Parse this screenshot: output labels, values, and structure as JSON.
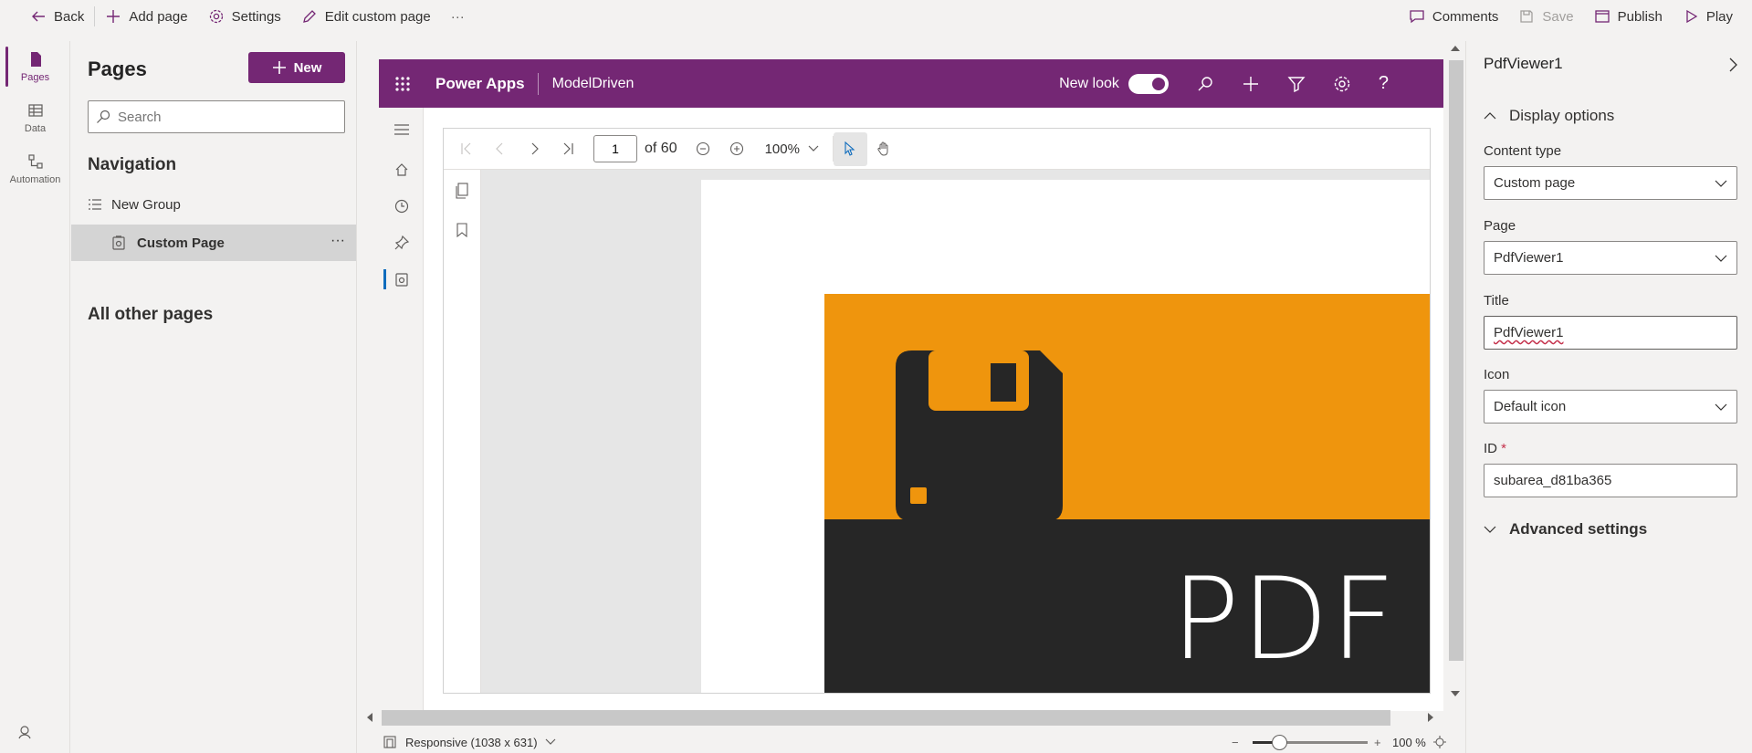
{
  "toolbar": {
    "back": "Back",
    "add_page": "Add page",
    "settings": "Settings",
    "edit_custom_page": "Edit custom page",
    "more": "···",
    "comments": "Comments",
    "save": "Save",
    "publish": "Publish",
    "play": "Play"
  },
  "rail": {
    "items": [
      {
        "label": "Pages",
        "icon": "page-icon",
        "active": true
      },
      {
        "label": "Data",
        "icon": "table-icon",
        "active": false
      },
      {
        "label": "Automation",
        "icon": "flow-icon",
        "active": false
      }
    ]
  },
  "pages_panel": {
    "title": "Pages",
    "new_label": "New",
    "search_placeholder": "Search",
    "navigation_heading": "Navigation",
    "group_label": "New Group",
    "page_label": "Custom Page",
    "page_more": "···",
    "other_heading": "All other pages"
  },
  "app": {
    "brand": "Power Apps",
    "app_name": "ModelDriven",
    "new_look": "New look",
    "new_look_on": true,
    "help": "?"
  },
  "pdf": {
    "current_page": "1",
    "of_pages": "of 60",
    "zoom": "100%",
    "cover_text": "PDF",
    "colors": {
      "orange": "#ef950d",
      "dark": "#262626"
    }
  },
  "canvas_footer": {
    "layout": "Responsive (1038 x 631)",
    "zoom_minus": "−",
    "zoom_plus": "+",
    "zoom_value": "100 %"
  },
  "props": {
    "title": "PdfViewer1",
    "display_options": "Display options",
    "content_type_label": "Content type",
    "content_type_value": "Custom page",
    "page_label": "Page",
    "page_value": "PdfViewer1",
    "title_label": "Title",
    "title_value": "PdfViewer1",
    "icon_label": "Icon",
    "icon_value": "Default icon",
    "id_label": "ID",
    "id_required": "*",
    "id_value": "subarea_d81ba365",
    "advanced_settings": "Advanced settings"
  },
  "colors": {
    "brand": "#742774",
    "accent_blue": "#0f6cbd"
  }
}
